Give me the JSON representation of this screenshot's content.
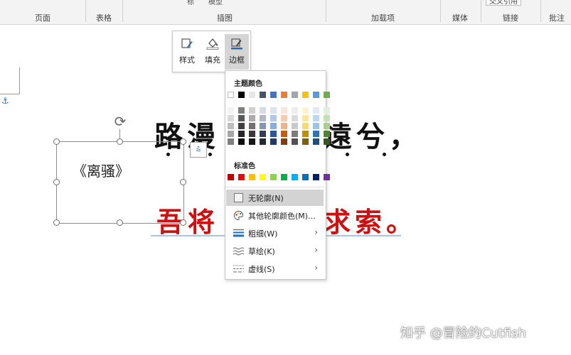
{
  "ribbon": {
    "groups": [
      "页面",
      "表格",
      "插图",
      "加载项",
      "媒体",
      "链接",
      "批注"
    ],
    "fragments": [
      "标",
      "模型"
    ],
    "link_button": "交叉引用"
  },
  "mini_toolbar": {
    "buttons": [
      {
        "label": "样式",
        "icon": "shape-style-icon"
      },
      {
        "label": "填充",
        "icon": "fill-bucket-icon"
      },
      {
        "label": "边框",
        "icon": "pen-outline-icon"
      }
    ]
  },
  "menu": {
    "theme_colors_title": "主题颜色",
    "standard_colors_title": "标准色",
    "theme_top": [
      "#ffffff",
      "#000000",
      "#e7e6e6",
      "#44546a",
      "#4472c4",
      "#ed7d31",
      "#a5a5a5",
      "#ffc000",
      "#5b9bd5",
      "#70ad47"
    ],
    "theme_shades": [
      [
        "#f2f2f2",
        "#7f7f7f",
        "#d0cece",
        "#d6dce5",
        "#dae3f3",
        "#fbe5d6",
        "#ededed",
        "#fff2cc",
        "#deebf7",
        "#e2f0d9"
      ],
      [
        "#d9d9d9",
        "#595959",
        "#aeabab",
        "#adb9ca",
        "#b4c7e7",
        "#f8cbad",
        "#dbdbdb",
        "#ffe699",
        "#bdd7ee",
        "#c5e0b4"
      ],
      [
        "#bfbfbf",
        "#404040",
        "#757171",
        "#8497b0",
        "#8faadc",
        "#f4b183",
        "#c9c9c9",
        "#ffd966",
        "#9dc3e6",
        "#a9d18e"
      ],
      [
        "#a6a6a6",
        "#262626",
        "#3a3838",
        "#333f50",
        "#2f5597",
        "#c55a11",
        "#7b7b7b",
        "#bf9000",
        "#2e75b6",
        "#548235"
      ],
      [
        "#7f7f7f",
        "#0d0d0d",
        "#171616",
        "#222a35",
        "#1f3864",
        "#843c0c",
        "#525252",
        "#7f6000",
        "#1f4e79",
        "#385723"
      ]
    ],
    "standard": [
      "#c00000",
      "#ff0000",
      "#ffc000",
      "#ffff00",
      "#92d050",
      "#00b050",
      "#00b0f0",
      "#0070c0",
      "#002060",
      "#7030a0"
    ],
    "items": [
      {
        "label": "无轮廓(N)",
        "icon": "no-outline-icon",
        "submenu": false
      },
      {
        "label": "其他轮廓颜色(M)...",
        "icon": "palette-icon",
        "submenu": false
      },
      {
        "label": "粗细(W)",
        "icon": "line-weight-icon",
        "submenu": true
      },
      {
        "label": "草绘(K)",
        "icon": "sketch-line-icon",
        "submenu": true
      },
      {
        "label": "虚线(S)",
        "icon": "dash-line-icon",
        "submenu": true
      }
    ],
    "submenu_arrow": "›"
  },
  "document": {
    "line1_part1": "路漫",
    "line1_part2": "遠兮，",
    "line2_part1": "吾将",
    "line2_part2": "求索。",
    "textbox_text": "《离骚》"
  },
  "watermark": "知乎 @冒险的Cutfish"
}
